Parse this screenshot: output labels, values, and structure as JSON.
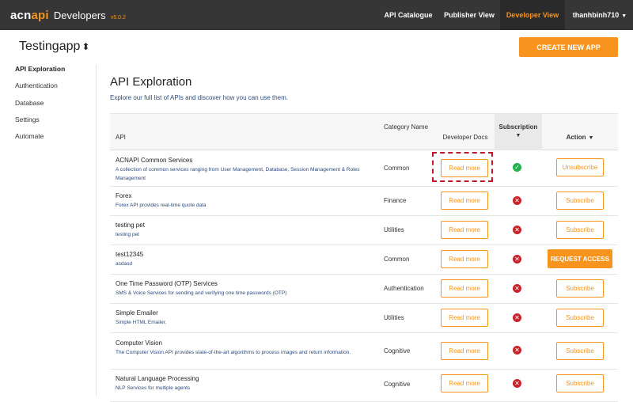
{
  "nav": {
    "brand_logo_a": "acn",
    "brand_logo_b": "api",
    "brand_dev": "Developers",
    "brand_version": "v5.0.2",
    "links": [
      "API Catalogue",
      "Publisher View",
      "Developer View"
    ],
    "active": "Developer View",
    "user": "thanhbinh710"
  },
  "header": {
    "app_name": "Testingapp",
    "create_button": "CREATE NEW APP"
  },
  "sidebar": {
    "items": [
      "API Exploration",
      "Authentication",
      "Database",
      "Settings",
      "Automate"
    ],
    "active": "API Exploration"
  },
  "main": {
    "title": "API Exploration",
    "subtitle": "Explore our full list of APIs and discover how you can use them.",
    "columns": {
      "api": "API",
      "category": "Category Name",
      "docs": "Developer Docs",
      "subscription": "Subscription",
      "action": "Action"
    },
    "rows": [
      {
        "name": "ACNAPI Common Services",
        "desc": "A collection of common services ranging from User Management, Database, Session Management & Roles Management",
        "category": "Common",
        "docs": "Read more",
        "subscribed": true,
        "action": "Unsubscribe"
      },
      {
        "name": "Forex",
        "desc": "Forex API provides real-time quote data",
        "category": "Finance",
        "docs": "Read more",
        "subscribed": false,
        "action": "Subscribe"
      },
      {
        "name": "testing pet",
        "desc": "testing pet",
        "category": "Utilities",
        "docs": "Read more",
        "subscribed": false,
        "action": "Subscribe"
      },
      {
        "name": "test12345",
        "desc": "asdasd",
        "category": "Common",
        "docs": "Read more",
        "subscribed": false,
        "action": "REQUEST ACCESS"
      },
      {
        "name": "One Time Password (OTP) Services",
        "desc": "SMS & Voice Services for sending and verifying one time passwords (OTP)",
        "category": "Authentication",
        "docs": "Read more",
        "subscribed": false,
        "action": "Subscribe"
      },
      {
        "name": "Simple Emailer",
        "desc": "Simple HTML Emailer.",
        "category": "Utilities",
        "docs": "Read more",
        "subscribed": false,
        "action": "Subscribe"
      },
      {
        "name": "Computer Vision",
        "desc": "The Computer Vision API provides state-of-the-art algorithms to process images and return information.",
        "category": "Cognitive",
        "docs": "Read more",
        "subscribed": false,
        "action": "Subscribe"
      },
      {
        "name": "Natural Language Processing",
        "desc": "NLP Services for multiple agents",
        "category": "Cognitive",
        "docs": "Read more",
        "subscribed": false,
        "action": "Subscribe"
      }
    ]
  },
  "icons": {
    "subscribed": "check-circle-icon",
    "not_subscribed": "x-circle-icon",
    "sort": "sort-updown-icon",
    "dropdown": "caret-down-icon"
  },
  "colors": {
    "accent": "#f7941d",
    "nav_bg": "#363636",
    "ok": "#22b14c",
    "error": "#c8232c",
    "link_text": "#2d4a7b",
    "focus_outline": "#c0152a"
  }
}
